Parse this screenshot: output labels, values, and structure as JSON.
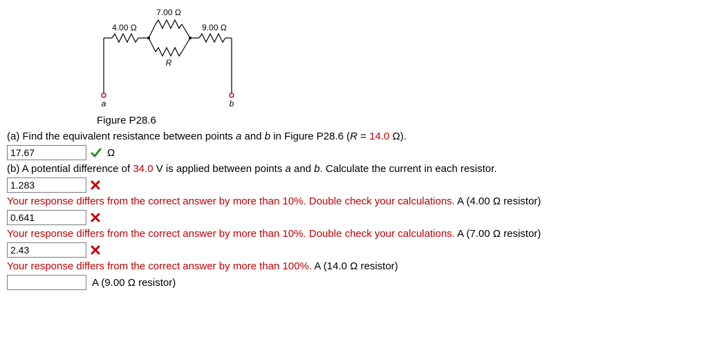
{
  "circuit": {
    "r_top": "7.00 Ω",
    "r_left": "4.00 Ω",
    "r_right": "9.00 Ω",
    "r_bottom_label": "R",
    "node_a": "a",
    "node_b": "b"
  },
  "figure_caption": "Figure P28.6",
  "partA": {
    "prompt_pre": "(a) Find the equivalent resistance between points ",
    "a": "a",
    "and": " and ",
    "b": "b",
    "prompt_mid": " in Figure P28.6 (",
    "R_eq": "R",
    "equals": " = ",
    "R_val": "14.0",
    "R_unit": " Ω).",
    "answer_value": "17.67",
    "unit": "Ω"
  },
  "partB": {
    "prompt_pre": "(b) A potential difference of ",
    "V_val": "34.0",
    "prompt_mid": " V is applied between points ",
    "a": "a",
    "and": " and ",
    "b": "b",
    "prompt_post": ". Calculate the current in each resistor.",
    "ans1_value": "1.283",
    "feedback1": "Your response differs from the correct answer by more than 10%. Double check your calculations.",
    "hint1": " A (4.00 Ω resistor)",
    "ans2_value": "0.641",
    "feedback2": "Your response differs from the correct answer by more than 10%. Double check your calculations.",
    "hint2": " A (7.00 Ω resistor)",
    "ans3_value": "2.43",
    "feedback3": "Your response differs from the correct answer by more than 100%.",
    "hint3": " A (14.0 Ω resistor)",
    "ans4_value": "",
    "hint4": " A (9.00 Ω resistor)"
  }
}
